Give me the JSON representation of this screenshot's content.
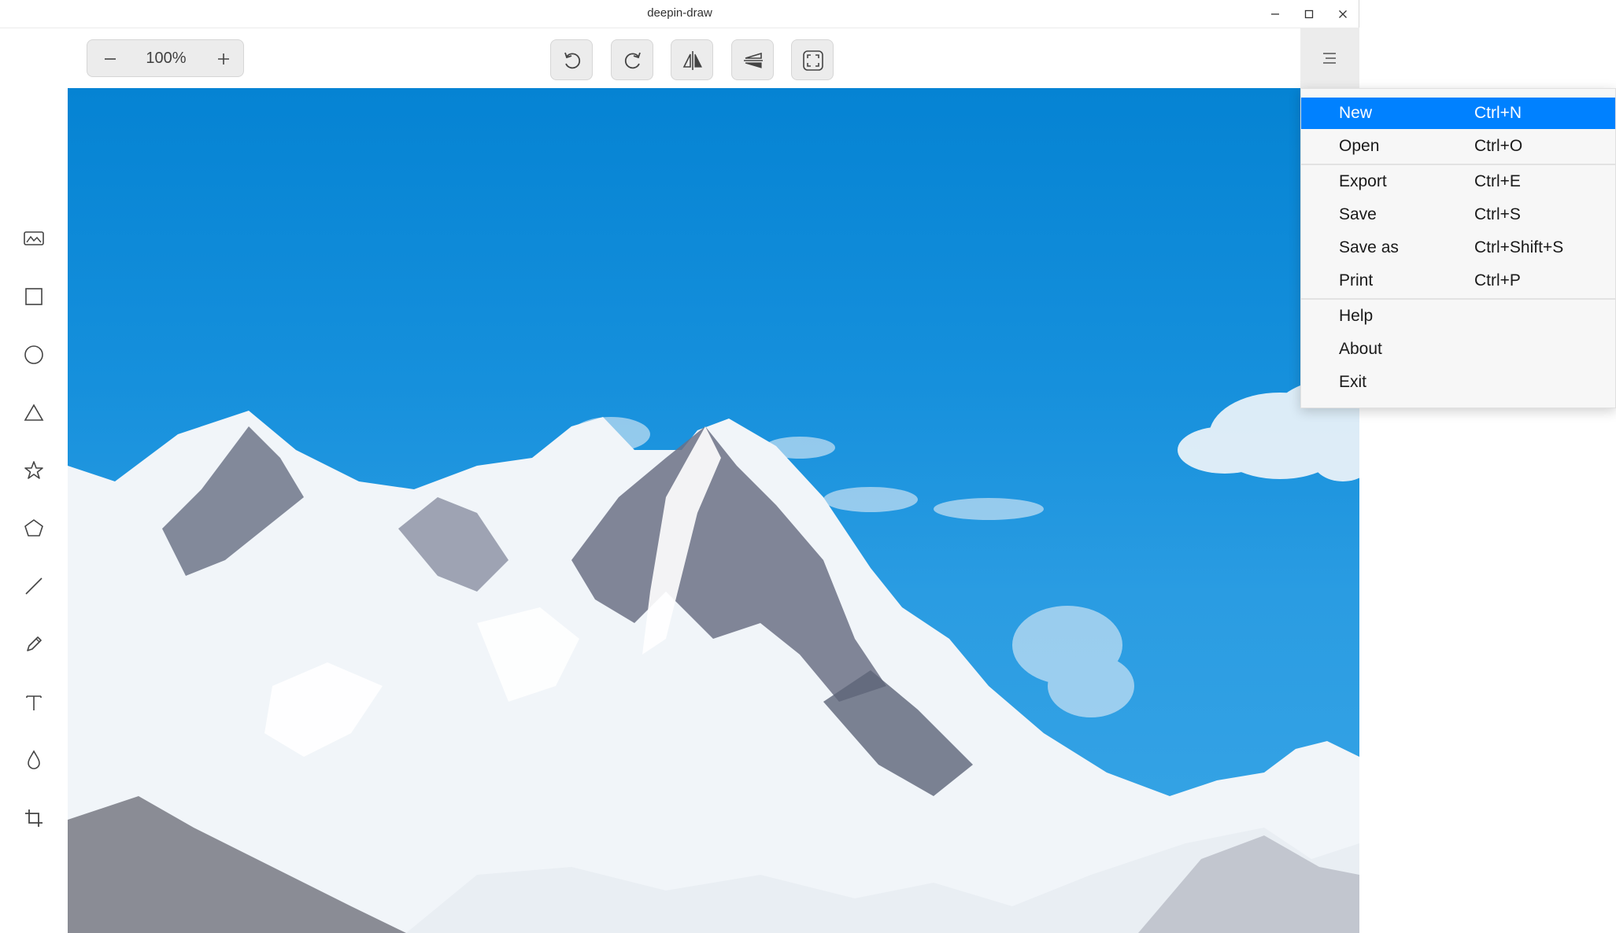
{
  "window": {
    "title": "deepin-draw"
  },
  "zoom": {
    "value": "100%"
  },
  "menu": {
    "groups": [
      [
        {
          "label": "New",
          "shortcut": "Ctrl+N",
          "highlighted": true
        },
        {
          "label": "Open",
          "shortcut": "Ctrl+O"
        }
      ],
      [
        {
          "label": "Export",
          "shortcut": "Ctrl+E"
        },
        {
          "label": "Save",
          "shortcut": "Ctrl+S"
        },
        {
          "label": "Save as",
          "shortcut": "Ctrl+Shift+S"
        },
        {
          "label": "Print",
          "shortcut": "Ctrl+P"
        }
      ],
      [
        {
          "label": "Help"
        },
        {
          "label": "About"
        },
        {
          "label": "Exit"
        }
      ]
    ]
  },
  "toolbar": {
    "icons": [
      "minus-icon",
      "plus-icon",
      "rotate-left-icon",
      "rotate-right-icon",
      "flip-horizontal-icon",
      "flip-vertical-icon",
      "fit-screen-icon",
      "hamburger-menu-icon"
    ]
  },
  "sidebar": {
    "tools": [
      "image-tool",
      "rectangle-tool",
      "ellipse-tool",
      "triangle-tool",
      "star-tool",
      "polygon-tool",
      "line-tool",
      "pencil-tool",
      "text-tool",
      "blur-tool",
      "crop-tool"
    ]
  },
  "colors": {
    "accent": "#0081ff",
    "sky_top": "#0583d3",
    "sky_bottom": "#3aa6e6",
    "snow": "#f4f7fa",
    "rock": "#5d6478"
  }
}
